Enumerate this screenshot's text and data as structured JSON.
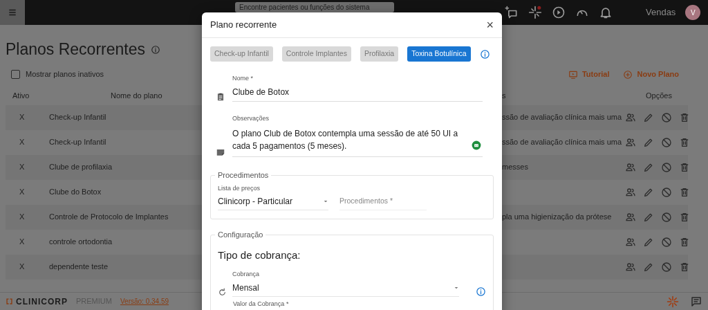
{
  "topbar": {
    "search": {
      "placeholder": "Encontre pacientes ou funções do sistema"
    },
    "user": "Vendas",
    "avatar": "V"
  },
  "page": {
    "title": "Planos Recorrentes",
    "show_inactive": {
      "label": "Mostrar planos inativos",
      "checked": false
    },
    "actions": [
      {
        "kind": "tutorial",
        "label": "Tutorial"
      },
      {
        "kind": "add",
        "label": "Novo Plano"
      }
    ]
  },
  "table": {
    "columns": [
      "Ativo",
      "Nome do plano",
      "s",
      "Opções"
    ],
    "rows": [
      {
        "active": "X",
        "name": "Check-up Infantil",
        "description": "ssão de avaliação clínica mais uma"
      },
      {
        "active": "X",
        "name": "Check-up Infantil",
        "description": "ssão de avaliação clínica mais uma"
      },
      {
        "active": "X",
        "name": "Clube de profilaxia",
        "description": "messes"
      },
      {
        "active": "X",
        "name": "Clube do Botox"
      },
      {
        "active": "X",
        "name": "Controle de Protocolo de Implantes",
        "description": "pla uma higienização da prótese"
      },
      {
        "active": "X",
        "name": "controle ortodontia"
      },
      {
        "active": "X",
        "name": "dependente teste"
      }
    ]
  },
  "footer": {
    "brand": "CLINICORP",
    "tier": "PREMIUM",
    "version": "Versão: 0.34.59"
  },
  "modal": {
    "title": "Plano recorrente",
    "close": "×",
    "templates": [
      {
        "label": "Check-up Infantil",
        "selected": false
      },
      {
        "label": "Controle Implantes",
        "selected": false
      },
      {
        "label": "Profilaxia",
        "selected": false
      },
      {
        "label": "Toxina Botulínica",
        "selected": true
      }
    ],
    "name": {
      "label": "Nome *",
      "value": "Clube de Botox"
    },
    "notes": {
      "label": "Observações",
      "value": "O plano Club de Botox contempla uma sessão de até 50 UI a cada 5 pagamentos (5 meses)."
    },
    "procedures": {
      "legend": "Procedimentos",
      "price_list": {
        "label": "Lista de preços",
        "value": "Clinicorp - Particular"
      },
      "procedures_field": {
        "placeholder": "Procedimentos *"
      }
    },
    "configuration": {
      "legend": "Configuração",
      "heading": "Tipo de cobrança:",
      "billing": {
        "label": "Cobrança",
        "value": "Mensal"
      },
      "amount": {
        "label": "Valor da Cobrança *"
      }
    }
  }
}
